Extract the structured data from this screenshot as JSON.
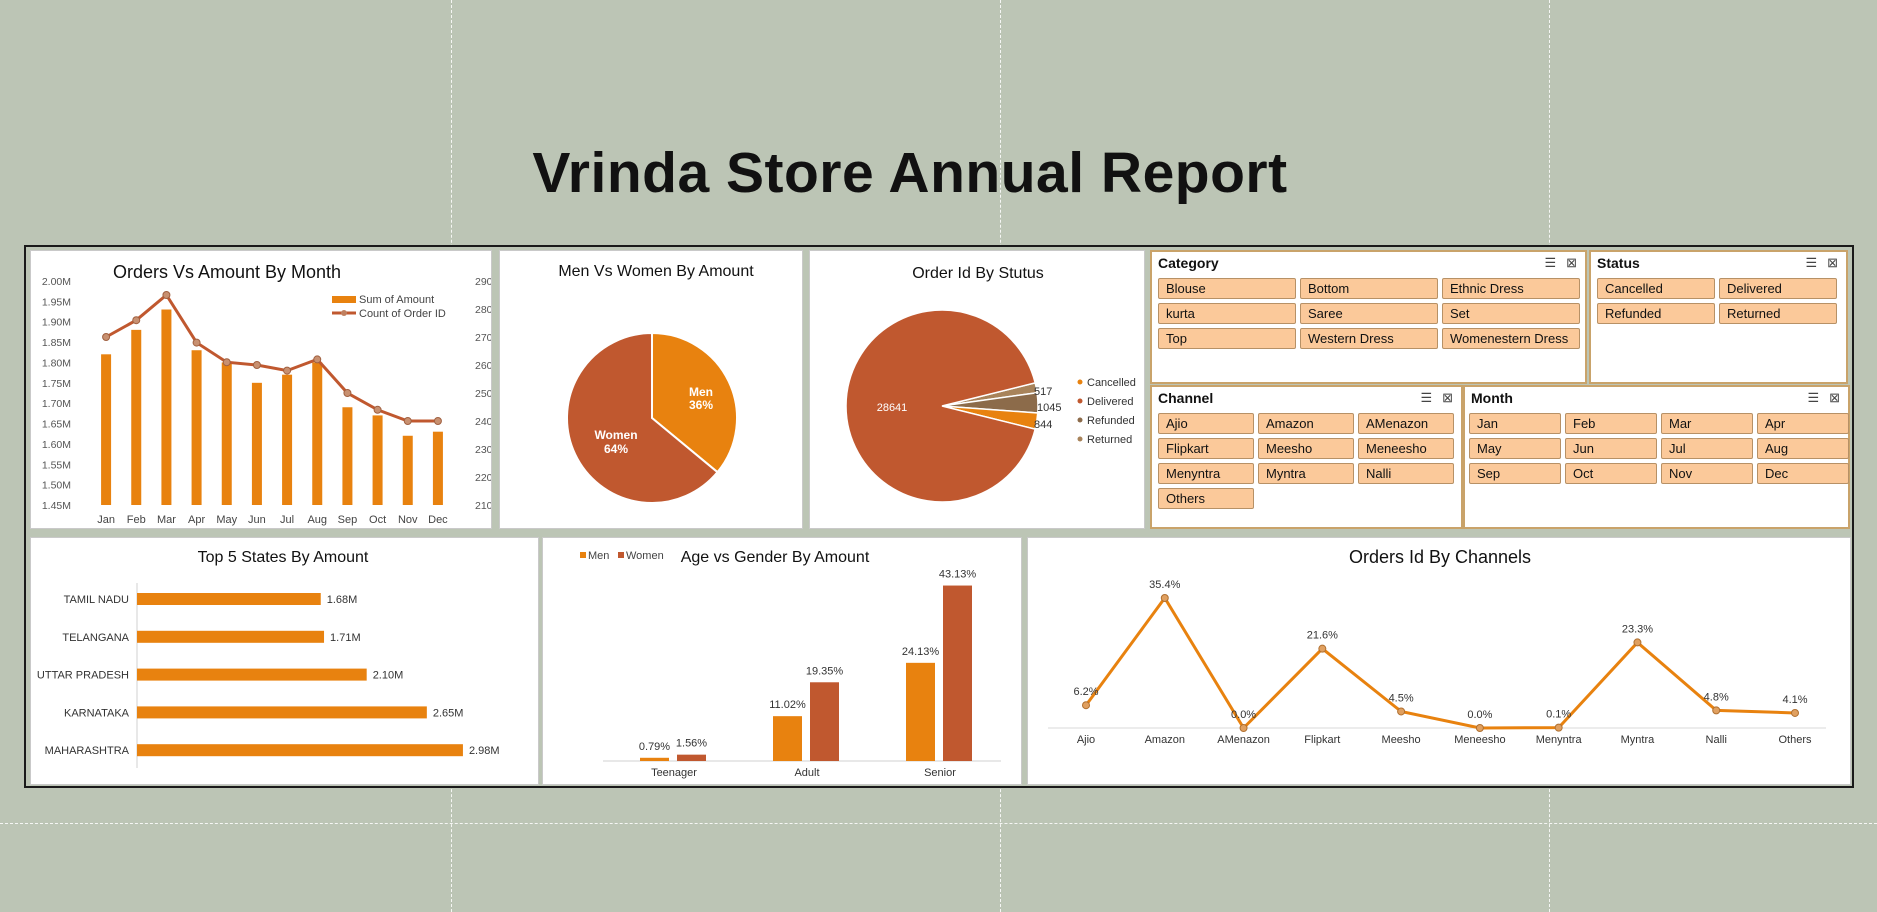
{
  "report_title": "Vrinda Store Annual Report",
  "colors": {
    "orange": "#e8820f",
    "rust": "#c0582f",
    "brown": "#8c6b4a",
    "tan": "#a8835a",
    "slicer_btn": "#fbc99a",
    "background": "#bcc5b5"
  },
  "charts": {
    "orders_vs_amount": {
      "title": "Orders Vs Amount By Month",
      "legend": [
        "Sum of Amount",
        "Count of Order ID"
      ],
      "left_ticks": [
        "1.45M",
        "1.50M",
        "1.55M",
        "1.60M",
        "1.65M",
        "1.70M",
        "1.75M",
        "1.80M",
        "1.85M",
        "1.90M",
        "1.95M",
        "2.00M"
      ],
      "right_ticks": [
        "2100",
        "2200",
        "2300",
        "2400",
        "2500",
        "2600",
        "2700",
        "2800",
        "2900"
      ]
    },
    "men_vs_women": {
      "title": "Men Vs Women By Amount",
      "men_name": "Men",
      "men_pct": "36%",
      "women_name": "Women",
      "women_pct": "64%"
    },
    "order_status": {
      "title": "Order Id By Stutus",
      "legend": [
        "Cancelled",
        "Delivered",
        "Refunded",
        "Returned"
      ],
      "labels": [
        "28641",
        "517",
        "1045",
        "844"
      ]
    },
    "top_states": {
      "title": "Top 5 States By Amount"
    },
    "age_gender": {
      "title": "Age vs Gender By Amount",
      "legend": [
        "Men",
        "Women"
      ]
    },
    "channels": {
      "title": "Orders Id By Channels"
    }
  },
  "chart_data": [
    {
      "type": "bar+line",
      "title": "Orders Vs Amount By Month",
      "categories": [
        "Jan",
        "Feb",
        "Mar",
        "Apr",
        "May",
        "Jun",
        "Jul",
        "Aug",
        "Sep",
        "Oct",
        "Nov",
        "Dec"
      ],
      "series": [
        {
          "name": "Sum of Amount",
          "type": "bar",
          "axis": "left",
          "values": [
            1.82,
            1.88,
            1.93,
            1.83,
            1.8,
            1.75,
            1.77,
            1.8,
            1.69,
            1.67,
            1.62,
            1.63
          ]
        },
        {
          "name": "Count of Order ID",
          "type": "line",
          "axis": "right",
          "values": [
            2700,
            2760,
            2850,
            2680,
            2610,
            2600,
            2580,
            2620,
            2500,
            2440,
            2400,
            2400
          ]
        }
      ],
      "ylim_left": [
        1.45,
        2.0
      ],
      "ylim_right": [
        2100,
        2900
      ]
    },
    {
      "type": "pie",
      "title": "Men Vs Women By Amount",
      "categories": [
        "Men",
        "Women"
      ],
      "values": [
        36,
        64
      ]
    },
    {
      "type": "pie",
      "title": "Order Id By Stutus",
      "categories": [
        "Cancelled",
        "Delivered",
        "Refunded",
        "Returned"
      ],
      "values": [
        844,
        28641,
        1045,
        517
      ]
    },
    {
      "type": "bar",
      "orientation": "horizontal",
      "title": "Top 5 States By Amount",
      "categories": [
        "TAMIL NADU",
        "TELANGANA",
        "UTTAR PRADESH",
        "KARNATAKA",
        "MAHARASHTRA"
      ],
      "values": [
        1.68,
        1.71,
        2.1,
        2.65,
        2.98
      ],
      "labels": [
        "1.68M",
        "1.71M",
        "2.10M",
        "2.65M",
        "2.98M"
      ]
    },
    {
      "type": "bar",
      "title": "Age vs Gender By Amount",
      "categories": [
        "Teenager",
        "Adult",
        "Senior"
      ],
      "series": [
        {
          "name": "Men",
          "values": [
            0.79,
            11.02,
            24.13
          ],
          "labels": [
            "0.79%",
            "11.02%",
            "24.13%"
          ]
        },
        {
          "name": "Women",
          "values": [
            1.56,
            19.35,
            43.13
          ],
          "labels": [
            "1.56%",
            "19.35%",
            "43.13%"
          ]
        }
      ]
    },
    {
      "type": "line",
      "title": "Orders Id By Channels",
      "categories": [
        "Ajio",
        "Amazon",
        "AMenazon",
        "Flipkart",
        "Meesho",
        "Meneesho",
        "Menyntra",
        "Myntra",
        "Nalli",
        "Others"
      ],
      "values": [
        6.2,
        35.4,
        0.0,
        21.6,
        4.5,
        0.0,
        0.1,
        23.3,
        4.8,
        4.1
      ],
      "labels": [
        "6.2%",
        "35.4%",
        "0.0%",
        "21.6%",
        "4.5%",
        "0.0%",
        "0.1%",
        "23.3%",
        "4.8%",
        "4.1%"
      ]
    }
  ],
  "slicers": {
    "category": {
      "title": "Category",
      "items": [
        "Blouse",
        "Bottom",
        "Ethnic Dress",
        "kurta",
        "Saree",
        "Set",
        "Top",
        "Western Dress",
        "Womenestern Dress"
      ]
    },
    "status": {
      "title": "Status",
      "items": [
        "Cancelled",
        "Delivered",
        "Refunded",
        "Returned"
      ]
    },
    "channel": {
      "title": "Channel",
      "items": [
        "Ajio",
        "Amazon",
        "AMenazon",
        "Flipkart",
        "Meesho",
        "Meneesho",
        "Menyntra",
        "Myntra",
        "Nalli",
        "Others"
      ]
    },
    "month": {
      "title": "Month",
      "items": [
        "Jan",
        "Feb",
        "Mar",
        "Apr",
        "May",
        "Jun",
        "Jul",
        "Aug",
        "Sep",
        "Oct",
        "Nov",
        "Dec"
      ]
    }
  }
}
